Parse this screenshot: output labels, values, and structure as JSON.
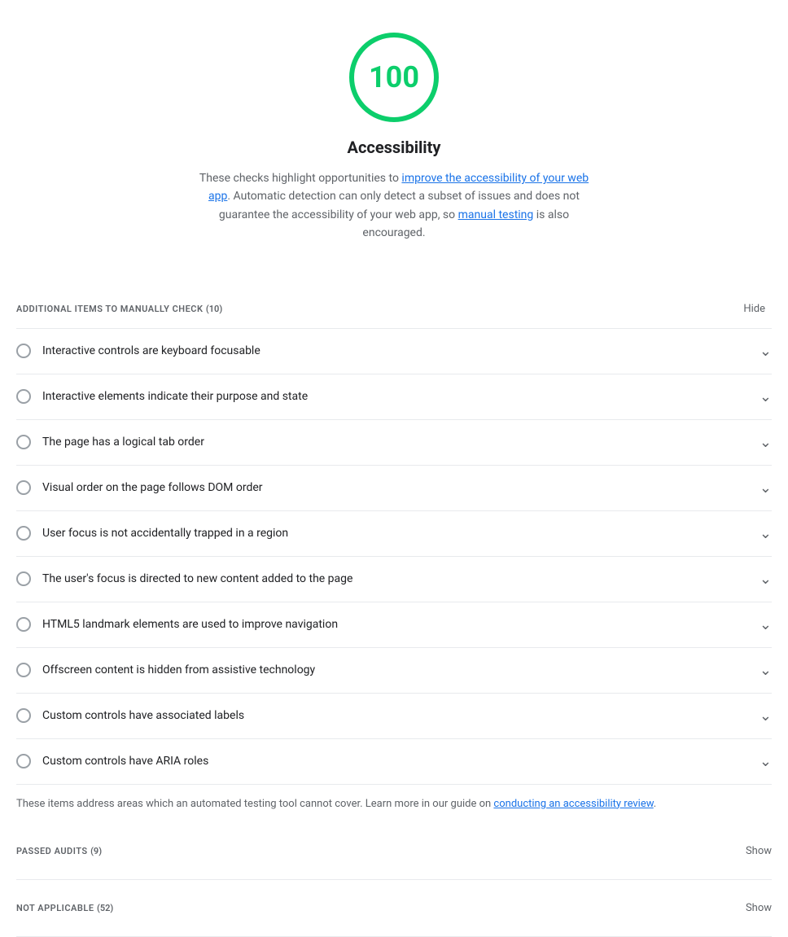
{
  "score": {
    "value": "100",
    "color": "#0cce6b",
    "title": "Accessibility",
    "description_part1": "These checks highlight opportunities to ",
    "description_link1": "improve the accessibility of your web app",
    "description_link1_href": "#",
    "description_part2": ". Automatic detection can only detect a subset of issues and does not guarantee the accessibility of your web app, so ",
    "description_link2": "manual testing",
    "description_link2_href": "#",
    "description_part3": " is also encouraged."
  },
  "manual_section": {
    "title": "ADDITIONAL ITEMS TO MANUALLY CHECK",
    "count": "(10)",
    "hide_label": "Hide"
  },
  "audit_items": [
    {
      "label": "Interactive controls are keyboard focusable"
    },
    {
      "label": "Interactive elements indicate their purpose and state"
    },
    {
      "label": "The page has a logical tab order"
    },
    {
      "label": "Visual order on the page follows DOM order"
    },
    {
      "label": "User focus is not accidentally trapped in a region"
    },
    {
      "label": "The user's focus is directed to new content added to the page"
    },
    {
      "label": "HTML5 landmark elements are used to improve navigation"
    },
    {
      "label": "Offscreen content is hidden from assistive technology"
    },
    {
      "label": "Custom controls have associated labels"
    },
    {
      "label": "Custom controls have ARIA roles"
    }
  ],
  "footer_note": {
    "text_before": "These items address areas which an automated testing tool cannot cover. Learn more in our guide on ",
    "link_text": "conducting an accessibility review",
    "link_href": "#",
    "text_after": "."
  },
  "passed_section": {
    "title": "PASSED AUDITS",
    "count": "(9)",
    "show_label": "Show"
  },
  "not_applicable_section": {
    "title": "NOT APPLICABLE",
    "count": "(52)",
    "show_label": "Show"
  }
}
